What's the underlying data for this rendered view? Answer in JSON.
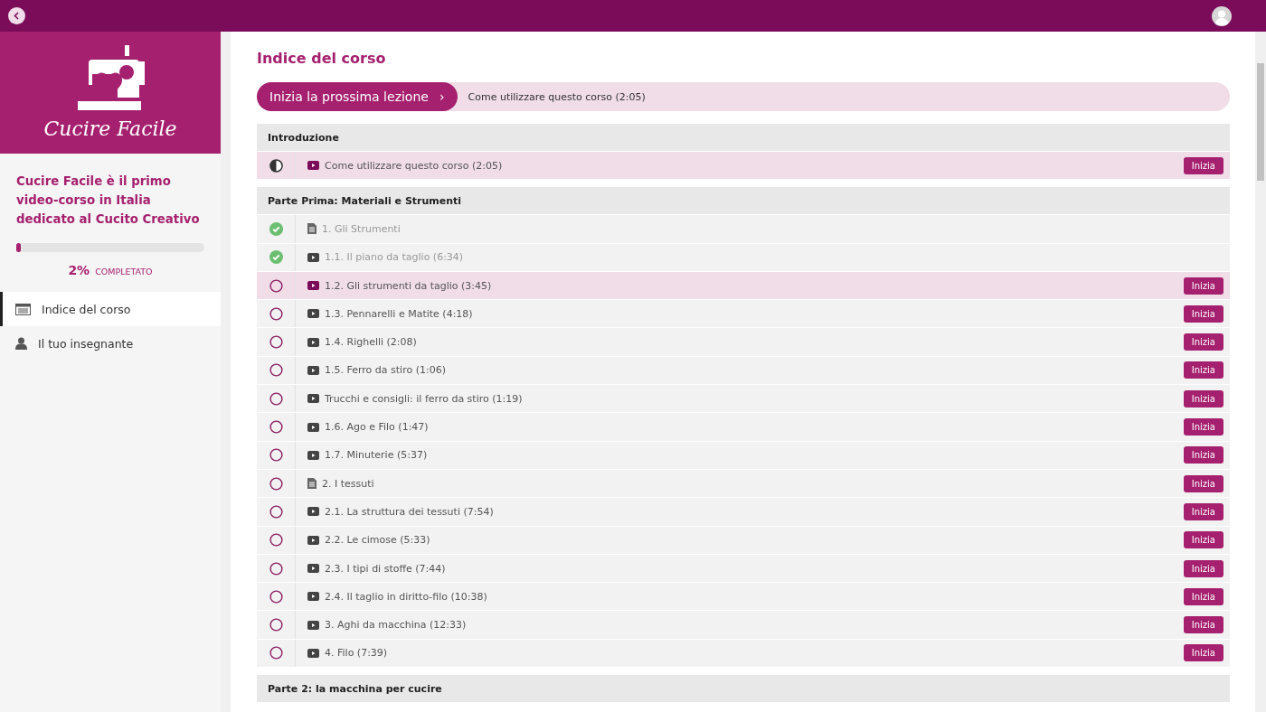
{
  "course": {
    "title": "Cucire Facile",
    "description": "Cucire Facile è il primo video-corso in Italia dedicato al Cucito Creativo",
    "progress": {
      "level": 0.02,
      "percent": "2%",
      "label": "COMPLETATO"
    }
  },
  "nav": [
    {
      "label": "Indice del corso",
      "selected": true
    },
    {
      "label": "Il tuo insegnante",
      "selected": false
    }
  ],
  "page_title": "Indice del corso",
  "next_lesson": {
    "button": "Inizia la prossima lezione",
    "arrow": "›",
    "lesson": "Come utilizzare questo corso (2:05)"
  },
  "sections": [
    {
      "title": "Introduzione",
      "lessons": [
        {
          "title": "Come utilizzare questo corso (2:05)",
          "kind": "video",
          "completed": false,
          "started": true,
          "current": true,
          "action": "Inizia"
        }
      ]
    },
    {
      "title": "Parte Prima: Materiali e Strumenti",
      "lessons": [
        {
          "title": "1. Gli Strumenti",
          "kind": "text",
          "completed": true,
          "started": false,
          "current": false
        },
        {
          "title": "1.1. Il piano da taglio (6:34)",
          "kind": "video",
          "completed": true,
          "started": false,
          "current": false
        },
        {
          "title": "1.2. Gli strumenti da taglio (3:45)",
          "kind": "video",
          "completed": false,
          "started": false,
          "current": true,
          "action": "Inizia"
        },
        {
          "title": "1.3. Pennarelli e Matite (4:18)",
          "kind": "video",
          "completed": false,
          "started": false,
          "current": false,
          "action": "Inizia"
        },
        {
          "title": "1.4. Righelli (2:08)",
          "kind": "video",
          "completed": false,
          "started": false,
          "current": false,
          "action": "Inizia"
        },
        {
          "title": "1.5. Ferro da stiro (1:06)",
          "kind": "video",
          "completed": false,
          "started": false,
          "current": false,
          "action": "Inizia"
        },
        {
          "title": "Trucchi e consigli: il ferro da stiro (1:19)",
          "kind": "video",
          "completed": false,
          "started": false,
          "current": false,
          "action": "Inizia"
        },
        {
          "title": "1.6. Ago e Filo (1:47)",
          "kind": "video",
          "completed": false,
          "started": false,
          "current": false,
          "action": "Inizia"
        },
        {
          "title": "1.7. Minuterie (5:37)",
          "kind": "video",
          "completed": false,
          "started": false,
          "current": false,
          "action": "Inizia"
        },
        {
          "title": "2. I tessuti",
          "kind": "text",
          "completed": false,
          "started": false,
          "current": false,
          "action": "Inizia"
        },
        {
          "title": "2.1. La struttura dei tessuti (7:54)",
          "kind": "video",
          "completed": false,
          "started": false,
          "current": false,
          "action": "Inizia"
        },
        {
          "title": "2.2. Le cimose (5:33)",
          "kind": "video",
          "completed": false,
          "started": false,
          "current": false,
          "action": "Inizia"
        },
        {
          "title": "2.3. I tipi di stoffe (7:44)",
          "kind": "video",
          "completed": false,
          "started": false,
          "current": false,
          "action": "Inizia"
        },
        {
          "title": "2.4. Il taglio in diritto-filo (10:38)",
          "kind": "video",
          "completed": false,
          "started": false,
          "current": false,
          "action": "Inizia"
        },
        {
          "title": "3. Aghi da macchina (12:33)",
          "kind": "video",
          "completed": false,
          "started": false,
          "current": false,
          "action": "Inizia"
        },
        {
          "title": "4. Filo (7:39)",
          "kind": "video",
          "completed": false,
          "started": false,
          "current": false,
          "action": "Inizia"
        }
      ]
    },
    {
      "title": "Parte 2: la macchina per cucire"
    }
  ]
}
